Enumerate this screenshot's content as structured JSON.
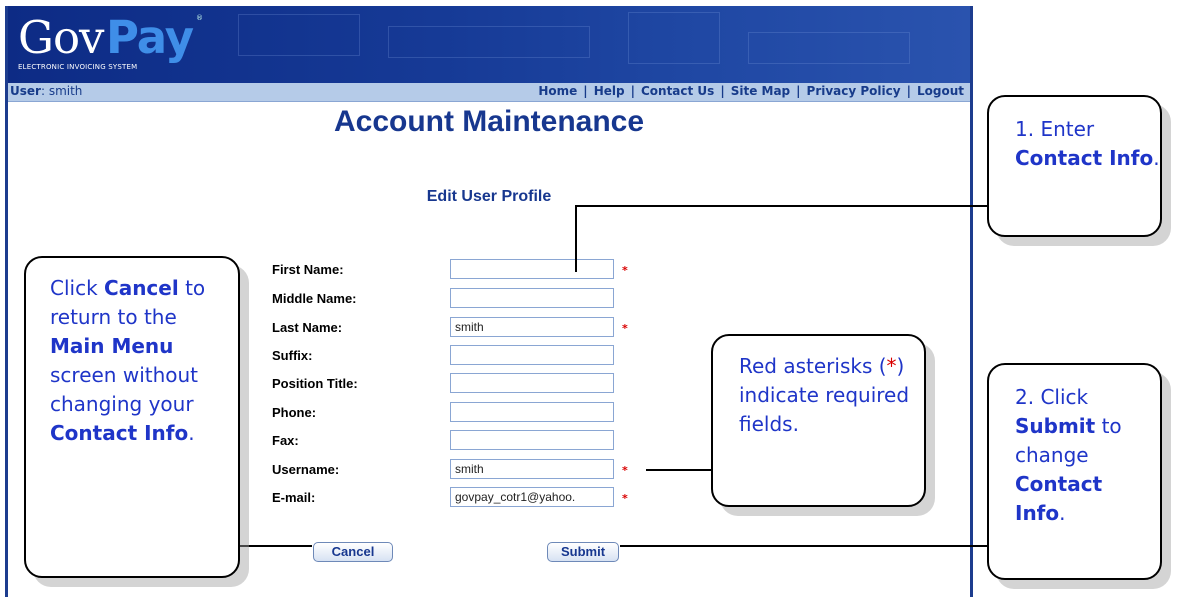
{
  "app": {
    "logo_gov": "Gov",
    "logo_pay": "Pay",
    "logo_trademark": "®",
    "logo_subtitle": "ELECTRONIC INVOICING SYSTEM"
  },
  "userbar": {
    "label": "User",
    "username": "smith"
  },
  "nav": {
    "items": [
      "Home",
      "Help",
      "Contact Us",
      "Site Map",
      "Privacy Policy",
      "Logout"
    ],
    "separator": "|"
  },
  "page": {
    "title": "Account Maintenance",
    "form_title": "Edit User Profile"
  },
  "form": {
    "fields": [
      {
        "label": "First Name:",
        "value": "",
        "required": true
      },
      {
        "label": "Middle Name:",
        "value": "",
        "required": false
      },
      {
        "label": "Last Name:",
        "value": "smith",
        "required": true
      },
      {
        "label": "Suffix:",
        "value": "",
        "required": false
      },
      {
        "label": "Position Title:",
        "value": "",
        "required": false
      },
      {
        "label": "Phone:",
        "value": "",
        "required": false
      },
      {
        "label": "Fax:",
        "value": "",
        "required": false
      },
      {
        "label": "Username:",
        "value": "smith",
        "required": true
      },
      {
        "label": "E-mail:",
        "value": "govpay_cotr1@yahoo.",
        "required": true
      }
    ],
    "required_marker": "*",
    "cancel_label": "Cancel",
    "submit_label": "Submit"
  },
  "callouts": {
    "enter_contact": {
      "prefix": "1. Enter",
      "bold": "Contact Info",
      "suffix": "."
    },
    "cancel": {
      "t1": "Click",
      "b1": "Cancel",
      "t2": "to return to the",
      "b2": "Main Menu",
      "t3": "screen without changing your",
      "b3": "Contact Info",
      "t4": "."
    },
    "asterisk": {
      "t1": "Red asterisks (",
      "star": "*",
      "t2": ") indicate required fields."
    },
    "submit": {
      "t1": "2. Click",
      "b1": "Submit",
      "t2": "to change",
      "b2": "Contact Info",
      "t3": "."
    }
  },
  "colors": {
    "banner": "#0d2b85",
    "accent_blue": "#17378f",
    "callout_text": "#1f35c8",
    "required_red": "#d90000"
  }
}
